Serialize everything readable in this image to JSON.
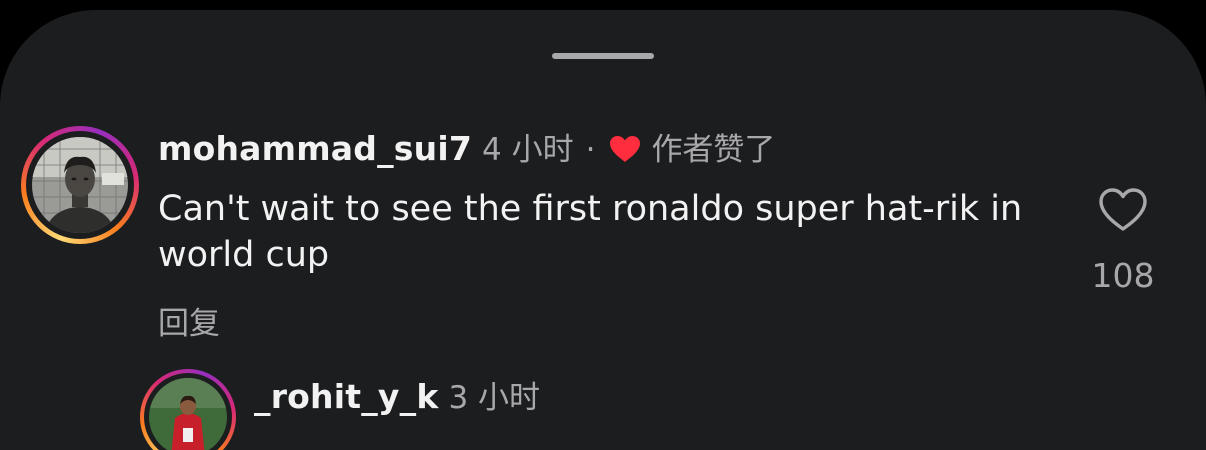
{
  "comments": [
    {
      "username": "mohammad_sui7",
      "time": "4 小时",
      "separator": "·",
      "author_liked_label": "作者赞了",
      "text": "Can't wait to see the first ronaldo super hat-rik in world cup",
      "reply_label": "回复",
      "like_count": "108",
      "avatar_icon": "user-avatar-photo",
      "like_icon": "heart-outline-icon"
    },
    {
      "username": "_rohit_y_k",
      "time": "3 小时",
      "avatar_icon": "user-avatar-photo"
    }
  ],
  "colors": {
    "background": "#1c1d1f",
    "primary_text": "#f2f2f2",
    "secondary_text": "#a8a8aa",
    "author_heart": "#ff2d3d",
    "story_ring_start": "#feda75",
    "story_ring_end": "#962fbf"
  }
}
